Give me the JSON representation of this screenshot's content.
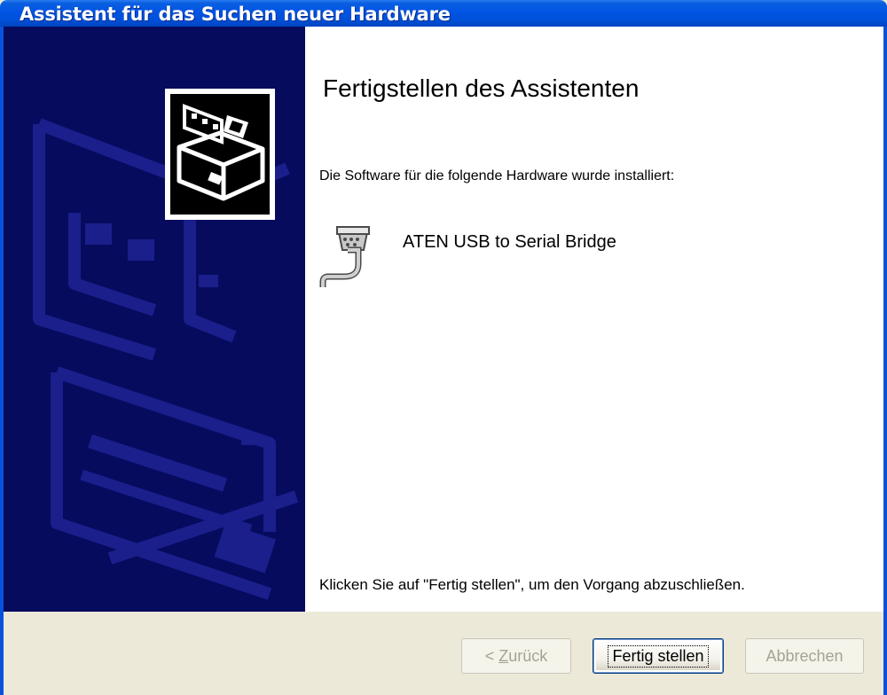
{
  "window": {
    "title": "Assistent für das Suchen neuer Hardware"
  },
  "content": {
    "heading": "Fertigstellen des Assistenten",
    "description": "Die Software für die folgende Hardware wurde installiert:",
    "device": {
      "name": "ATEN USB to Serial Bridge",
      "icon": "serial-port-icon"
    },
    "hint": "Klicken Sie auf \"Fertig stellen\", um den Vorgang abzuschließen."
  },
  "sidebar": {
    "icon": "hardware-wizard-icon"
  },
  "buttons": {
    "back": {
      "prefix": "< ",
      "mnemonic": "Z",
      "rest": "urück",
      "enabled": false
    },
    "finish": {
      "label": "Fertig stellen",
      "enabled": true
    },
    "cancel": {
      "label": "Abbrechen",
      "enabled": false
    }
  },
  "colors": {
    "titlebar": "#0054e3",
    "sidebar": "#060b5e",
    "sidebar_shapes": "#1a1f8c",
    "footer": "#ece9d8"
  }
}
